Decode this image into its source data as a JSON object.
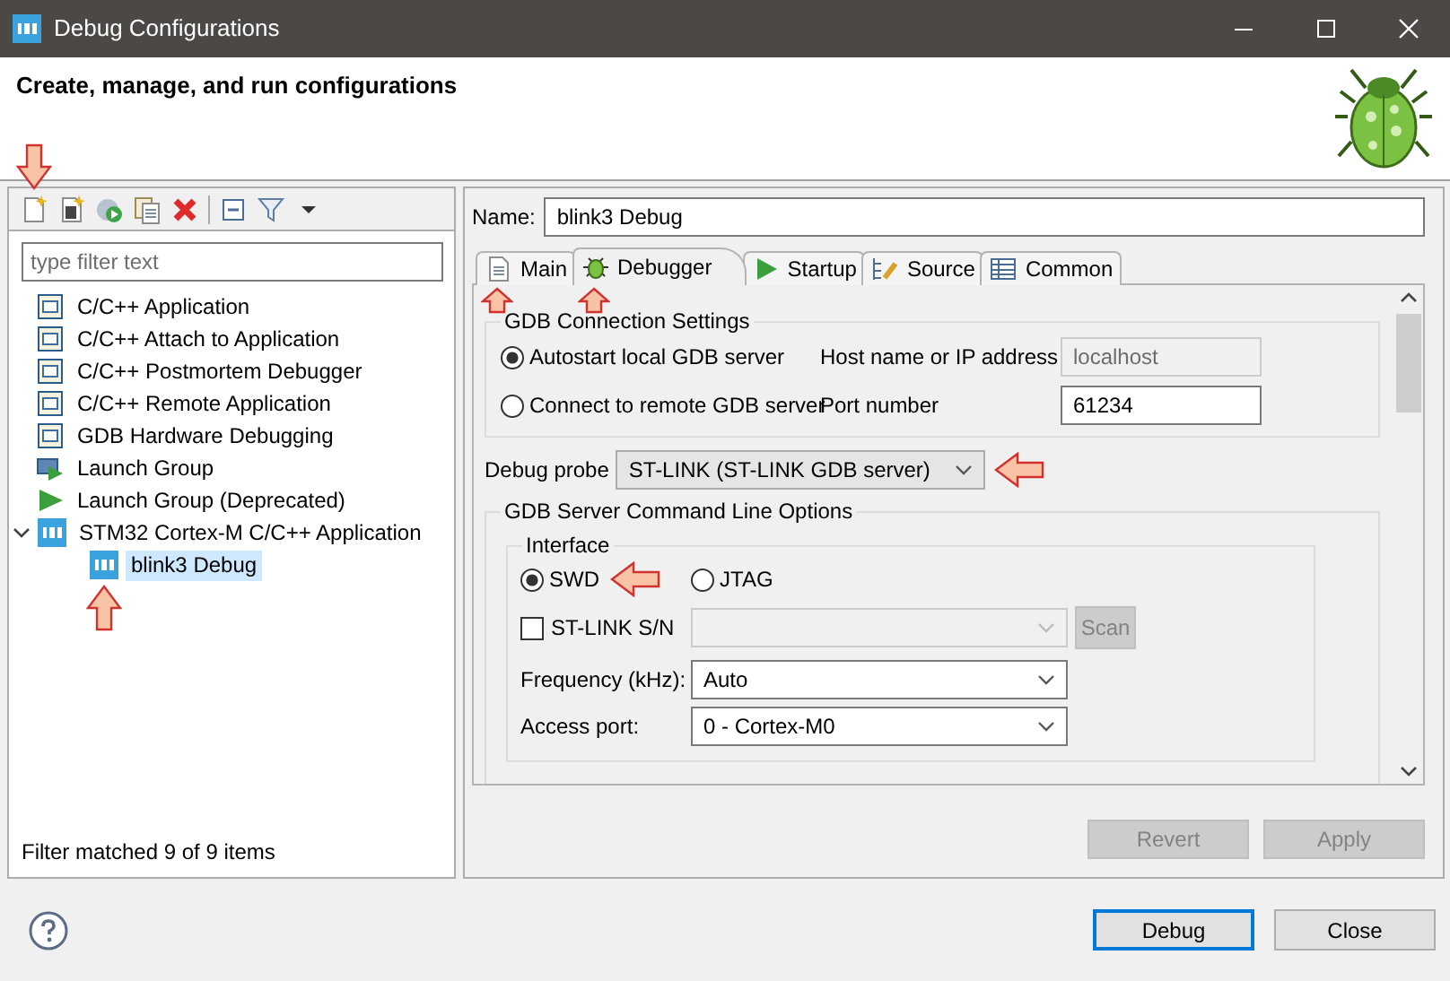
{
  "window": {
    "title": "Debug Configurations"
  },
  "header": {
    "title": "Create, manage, and run configurations"
  },
  "toolbar": [
    {
      "kind": "new",
      "arrow": true
    },
    {
      "kind": "prototype"
    },
    {
      "kind": "export"
    },
    {
      "kind": "duplicate"
    },
    {
      "kind": "delete"
    },
    {
      "kind": "separator"
    },
    {
      "kind": "collapse"
    },
    {
      "kind": "filter"
    },
    {
      "kind": "dropdown"
    }
  ],
  "filter": {
    "placeholder": "type filter text"
  },
  "tree": [
    {
      "label": "C/C++ Application",
      "kind": "c",
      "selected": false
    },
    {
      "label": "C/C++ Attach to Application",
      "kind": "c",
      "selected": false
    },
    {
      "label": "C/C++ Postmortem Debugger",
      "kind": "c",
      "selected": false
    },
    {
      "label": "C/C++ Remote Application",
      "kind": "c",
      "selected": false
    },
    {
      "label": "GDB Hardware Debugging",
      "kind": "c",
      "selected": false
    },
    {
      "label": "Launch Group",
      "kind": "group",
      "selected": false
    },
    {
      "label": "Launch Group (Deprecated)",
      "kind": "play",
      "selected": false
    },
    {
      "label": "STM32 Cortex-M C/C++ Application",
      "kind": "ide",
      "selected": false,
      "expanded": true,
      "children": [
        {
          "label": "blink3 Debug",
          "kind": "ide",
          "selected": true,
          "arrow": true
        }
      ]
    }
  ],
  "filter_status": "Filter matched 9 of 9 items",
  "name": {
    "label": "Name:",
    "value": "blink3 Debug"
  },
  "tabs": [
    {
      "label": "Main",
      "kind": "main",
      "selected": false,
      "arrow": true
    },
    {
      "label": "Debugger",
      "kind": "debugger",
      "selected": true,
      "arrow": true
    },
    {
      "label": "Startup",
      "kind": "startup",
      "selected": false
    },
    {
      "label": "Source",
      "kind": "source",
      "selected": false
    },
    {
      "label": "Common",
      "kind": "common",
      "selected": false
    }
  ],
  "connection": {
    "title": "GDB Connection Settings",
    "options": [
      {
        "label": "Autostart local GDB server",
        "selected": true
      },
      {
        "label": "Connect to remote GDB server",
        "selected": false
      }
    ],
    "host": {
      "label": "Host name or IP address",
      "value": "localhost",
      "disabled": true
    },
    "port": {
      "label": "Port number",
      "value": "61234",
      "disabled": false
    }
  },
  "probe": {
    "label": "Debug probe",
    "value": "ST-LINK (ST-LINK GDB server)",
    "arrow": true
  },
  "server_options": {
    "title": "GDB Server Command Line Options",
    "interface": {
      "title": "Interface",
      "options": [
        {
          "label": "SWD",
          "selected": true,
          "arrow": true
        },
        {
          "label": "JTAG",
          "selected": false
        }
      ]
    },
    "serial": {
      "label": "ST-LINK S/N",
      "checked": false,
      "button": "Scan",
      "disabled": true
    },
    "frequency": {
      "label": "Frequency (kHz):",
      "value": "Auto"
    },
    "access_port": {
      "label": "Access port:",
      "value": "0 - Cortex-M0"
    }
  },
  "actions": [
    {
      "label": "Revert",
      "disabled": true
    },
    {
      "label": "Apply",
      "disabled": true
    }
  ],
  "buttons": [
    {
      "label": "Debug",
      "default": true
    },
    {
      "label": "Close",
      "default": false
    }
  ]
}
